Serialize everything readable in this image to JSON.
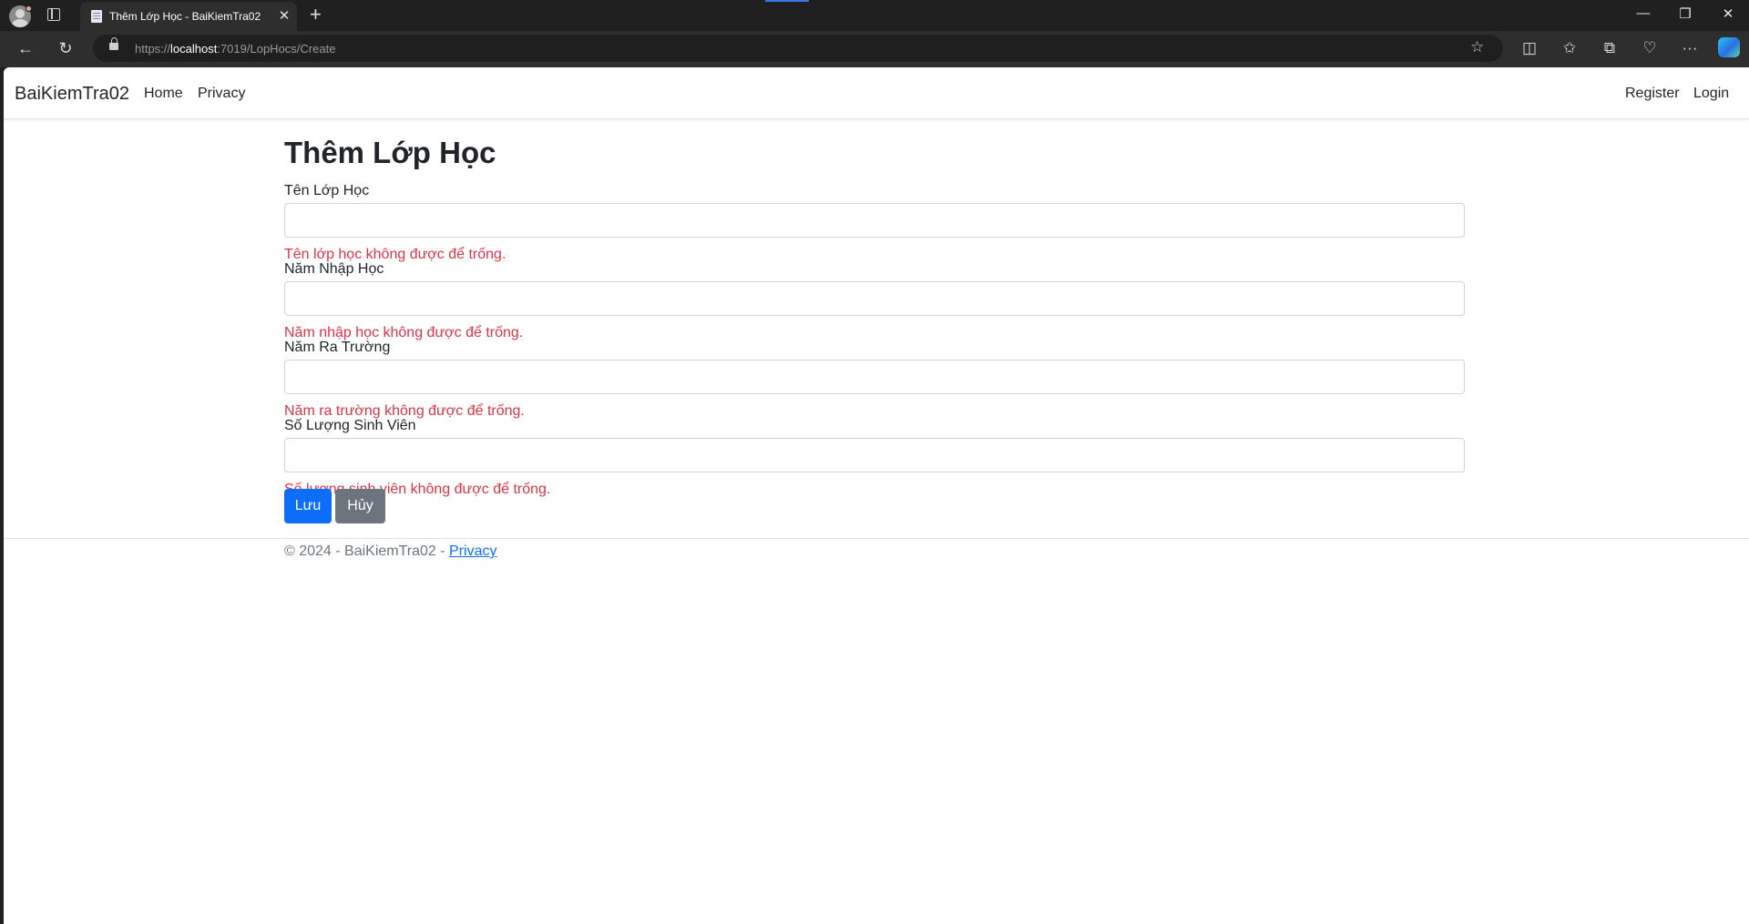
{
  "browser": {
    "tab_title": "Thêm Lớp Học - BaiKiemTra02",
    "tab_close": "✕",
    "new_tab": "+",
    "url_prefix": "https://",
    "url_host": "localhost",
    "url_rest": ":7019/LopHocs/Create",
    "window": {
      "minimize": "—",
      "restore": "❐",
      "close": "✕"
    },
    "nav": {
      "back": "←",
      "refresh": "↻"
    },
    "tools": {
      "favorite": "☆",
      "split": "◫",
      "favorites": "✩",
      "collections": "⧉",
      "health": "♡",
      "more": "···"
    }
  },
  "site": {
    "brand": "BaiKiemTra02",
    "nav": {
      "home": "Home",
      "privacy": "Privacy",
      "register": "Register",
      "login": "Login"
    }
  },
  "form": {
    "title": "Thêm Lớp Học",
    "fields": [
      {
        "label": "Tên Lớp Học",
        "value": "",
        "error": "Tên lớp học không được để trống."
      },
      {
        "label": "Năm Nhập Học",
        "value": "",
        "error": "Năm nhập học không được để trống."
      },
      {
        "label": "Năm Ra Trường",
        "value": "",
        "error": "Năm ra trường không được để trống."
      },
      {
        "label": "Số Lượng Sinh Viên",
        "value": "",
        "error": "Số lượng sinh viên không được để trống."
      }
    ],
    "save_label": "Lưu",
    "cancel_label": "Hủy"
  },
  "footer": {
    "text": "© 2024 - BaiKiemTra02 - ",
    "privacy_link": "Privacy"
  },
  "colors": {
    "primary": "#0d6efd",
    "secondary": "#6c757d",
    "danger": "#dc3545",
    "browser_dark": "#202020"
  }
}
